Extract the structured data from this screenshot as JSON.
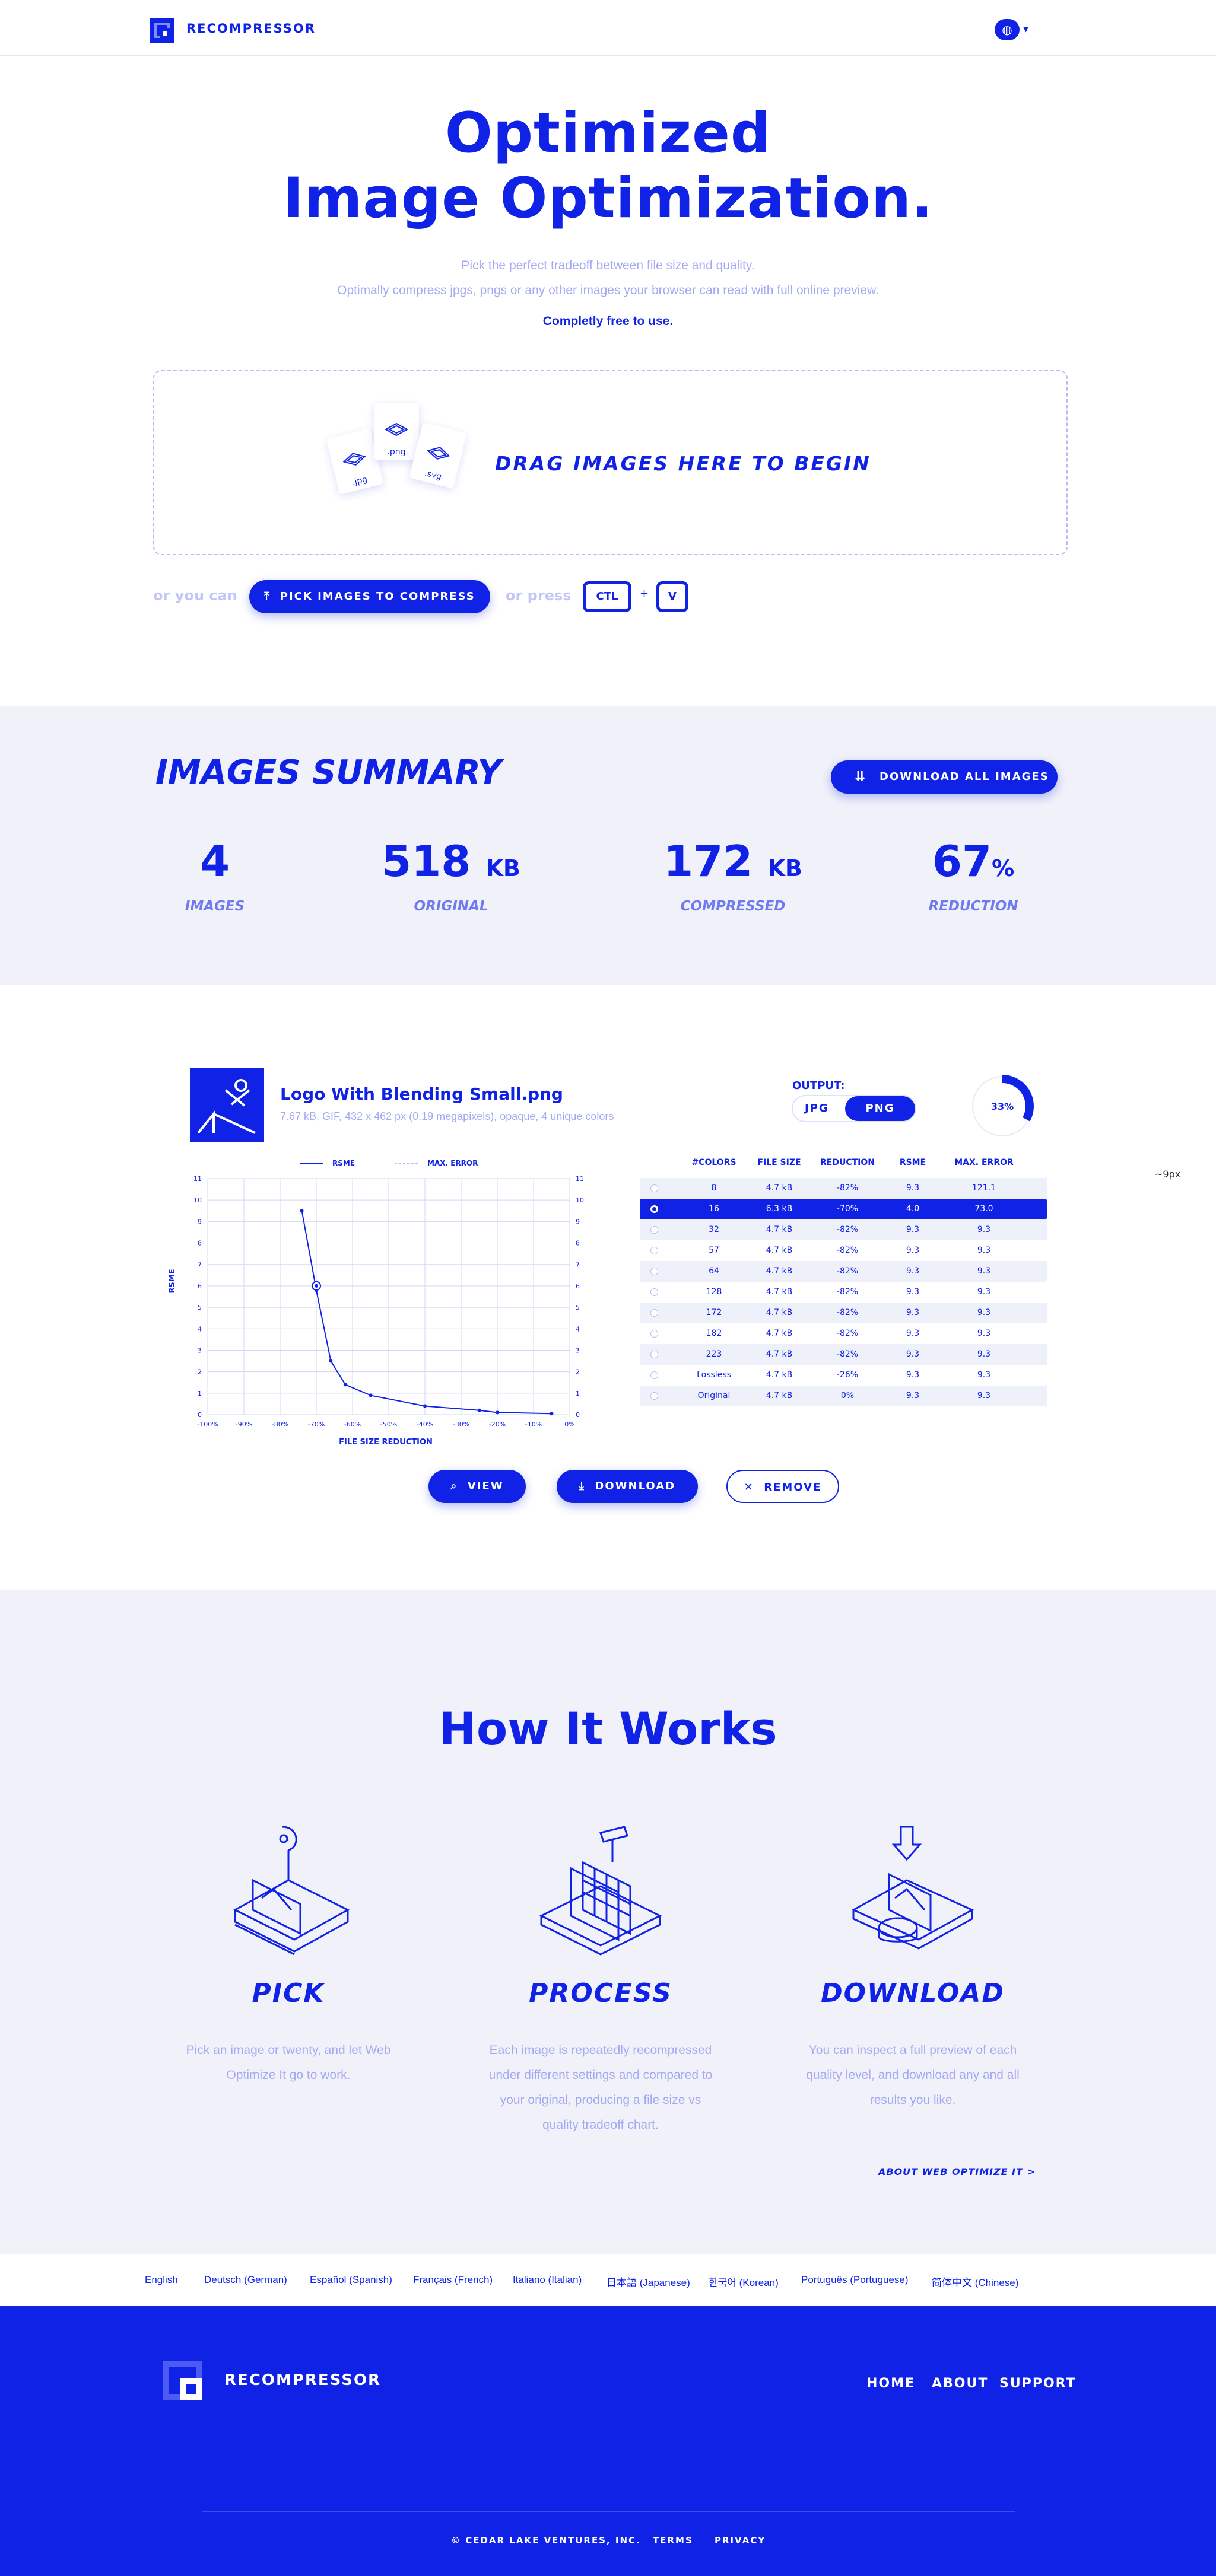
{
  "header": {
    "brand": "RECOMPRESSOR",
    "language_icon": "globe-icon"
  },
  "hero": {
    "title_line1": "Optimized",
    "title_line2": "Image Optimization.",
    "subtitle_line1": "Pick the perfect tradeoff between file size and quality.",
    "subtitle_line2": "Optimally compress jpgs, pngs or any other images your browser can read with full online preview.",
    "free_note": "Completly free to use.",
    "drop_text": "DRAG IMAGES HERE TO BEGIN",
    "file_labels": [
      ".jpg",
      ".png",
      ".svg"
    ],
    "or_you_can": "or you can",
    "pick_button": "PICK IMAGES TO COMPRESS",
    "or_press": "or press",
    "key_ctl": "CTL",
    "key_plus": "+",
    "key_v": "V"
  },
  "summary": {
    "title": "IMAGES SUMMARY",
    "download_all": "DOWNLOAD ALL IMAGES",
    "stats": [
      {
        "value": "4",
        "unit": "",
        "label": "IMAGES"
      },
      {
        "value": "518",
        "unit": "KB",
        "label": "ORIGINAL"
      },
      {
        "value": "172",
        "unit": "KB",
        "label": "COMPRESSED"
      },
      {
        "value": "67",
        "unit": "%",
        "label": "REDUCTION"
      }
    ]
  },
  "file": {
    "name": "Logo With Blending Small.png",
    "meta": "7.67 kB,  GIF,  432 x 462 px (0.19 megapixels), opaque, 4 unique colors",
    "output_label": "OUTPUT:",
    "format_jpg": "JPG",
    "format_png": "PNG",
    "progress_label": "33%",
    "progress_value": 0.33,
    "stray_text": "~9px"
  },
  "chart_data": {
    "type": "line",
    "legend": [
      "RSME",
      "MAX. ERROR"
    ],
    "xlabel": "FILE SIZE REDUCTION",
    "ylabel": "RSME",
    "x_ticks": [
      "-100%",
      "-90%",
      "-80%",
      "-70%",
      "-60%",
      "-50%",
      "-40%",
      "-30%",
      "-20%",
      "-10%",
      "0%"
    ],
    "y_ticks": [
      "0",
      "1",
      "2",
      "3",
      "4",
      "5",
      "6",
      "7",
      "8",
      "9",
      "10",
      "11"
    ],
    "xlim": [
      -100,
      0
    ],
    "ylim": [
      0,
      11
    ],
    "series": [
      {
        "name": "RSME",
        "x": [
          -74,
          -70,
          -66,
          -62,
          -55,
          -40,
          -25,
          -20,
          -5
        ],
        "y": [
          9.5,
          5.8,
          2.5,
          1.4,
          0.9,
          0.4,
          0.2,
          0.1,
          0.05
        ]
      }
    ],
    "selected_point": {
      "x": -70,
      "y": 6.0
    }
  },
  "table": {
    "headers": [
      "#COLORS",
      "FILE SIZE",
      "REDUCTION",
      "RSME",
      "MAX. ERROR"
    ],
    "rows": [
      {
        "colors": "8",
        "size": "4.7 kB",
        "reduction": "-82%",
        "rsme": "9.3",
        "max": "121.1",
        "selected": false
      },
      {
        "colors": "16",
        "size": "6.3 kB",
        "reduction": "-70%",
        "rsme": "4.0",
        "max": "73.0",
        "selected": true
      },
      {
        "colors": "32",
        "size": "4.7 kB",
        "reduction": "-82%",
        "rsme": "9.3",
        "max": "9.3",
        "selected": false
      },
      {
        "colors": "57",
        "size": "4.7 kB",
        "reduction": "-82%",
        "rsme": "9.3",
        "max": "9.3",
        "selected": false
      },
      {
        "colors": "64",
        "size": "4.7 kB",
        "reduction": "-82%",
        "rsme": "9.3",
        "max": "9.3",
        "selected": false
      },
      {
        "colors": "128",
        "size": "4.7 kB",
        "reduction": "-82%",
        "rsme": "9.3",
        "max": "9.3",
        "selected": false
      },
      {
        "colors": "172",
        "size": "4.7 kB",
        "reduction": "-82%",
        "rsme": "9.3",
        "max": "9.3",
        "selected": false
      },
      {
        "colors": "182",
        "size": "4.7 kB",
        "reduction": "-82%",
        "rsme": "9.3",
        "max": "9.3",
        "selected": false
      },
      {
        "colors": "223",
        "size": "4.7 kB",
        "reduction": "-82%",
        "rsme": "9.3",
        "max": "9.3",
        "selected": false
      },
      {
        "colors": "Lossless",
        "size": "4.7 kB",
        "reduction": "-26%",
        "rsme": "9.3",
        "max": "9.3",
        "selected": false
      },
      {
        "colors": "Original",
        "size": "4.7 kB",
        "reduction": "0%",
        "rsme": "9.3",
        "max": "9.3",
        "selected": false
      }
    ]
  },
  "actions": {
    "view": "VIEW",
    "download": "DOWNLOAD",
    "remove": "REMOVE"
  },
  "how": {
    "title": "How It Works",
    "steps": [
      {
        "title": "PICK",
        "text": [
          "Pick an image or twenty, and let Web",
          "Optimize It go to work."
        ]
      },
      {
        "title": "PROCESS",
        "text": [
          "Each image is repeatedly recompressed",
          "under different settings and compared to",
          "your original, producing a file size vs",
          "quality tradeoff chart."
        ]
      },
      {
        "title": "DOWNLOAD",
        "text": [
          "You can inspect a full preview of each",
          "quality level, and download any and all",
          "results you like."
        ]
      }
    ],
    "about_link": "ABOUT WEB OPTIMIZE IT >"
  },
  "languages": [
    "English",
    "Deutsch (German)",
    "Español (Spanish)",
    "Français (French)",
    "Italiano (Italian)",
    "日本語 (Japanese)",
    "한국어 (Korean)",
    "Português (Portuguese)",
    "简体中文 (Chinese)"
  ],
  "footer": {
    "brand": "RECOMPRESSOR",
    "nav": [
      "HOME",
      "ABOUT",
      "SUPPORT"
    ],
    "copyright": "© CEDAR LAKE VENTURES, INC.",
    "terms": "TERMS",
    "privacy": "PRIVACY"
  },
  "colors": {
    "accent": "#0f22e6",
    "muted": "#a3a9f2",
    "panel": "#f0f1f9"
  }
}
